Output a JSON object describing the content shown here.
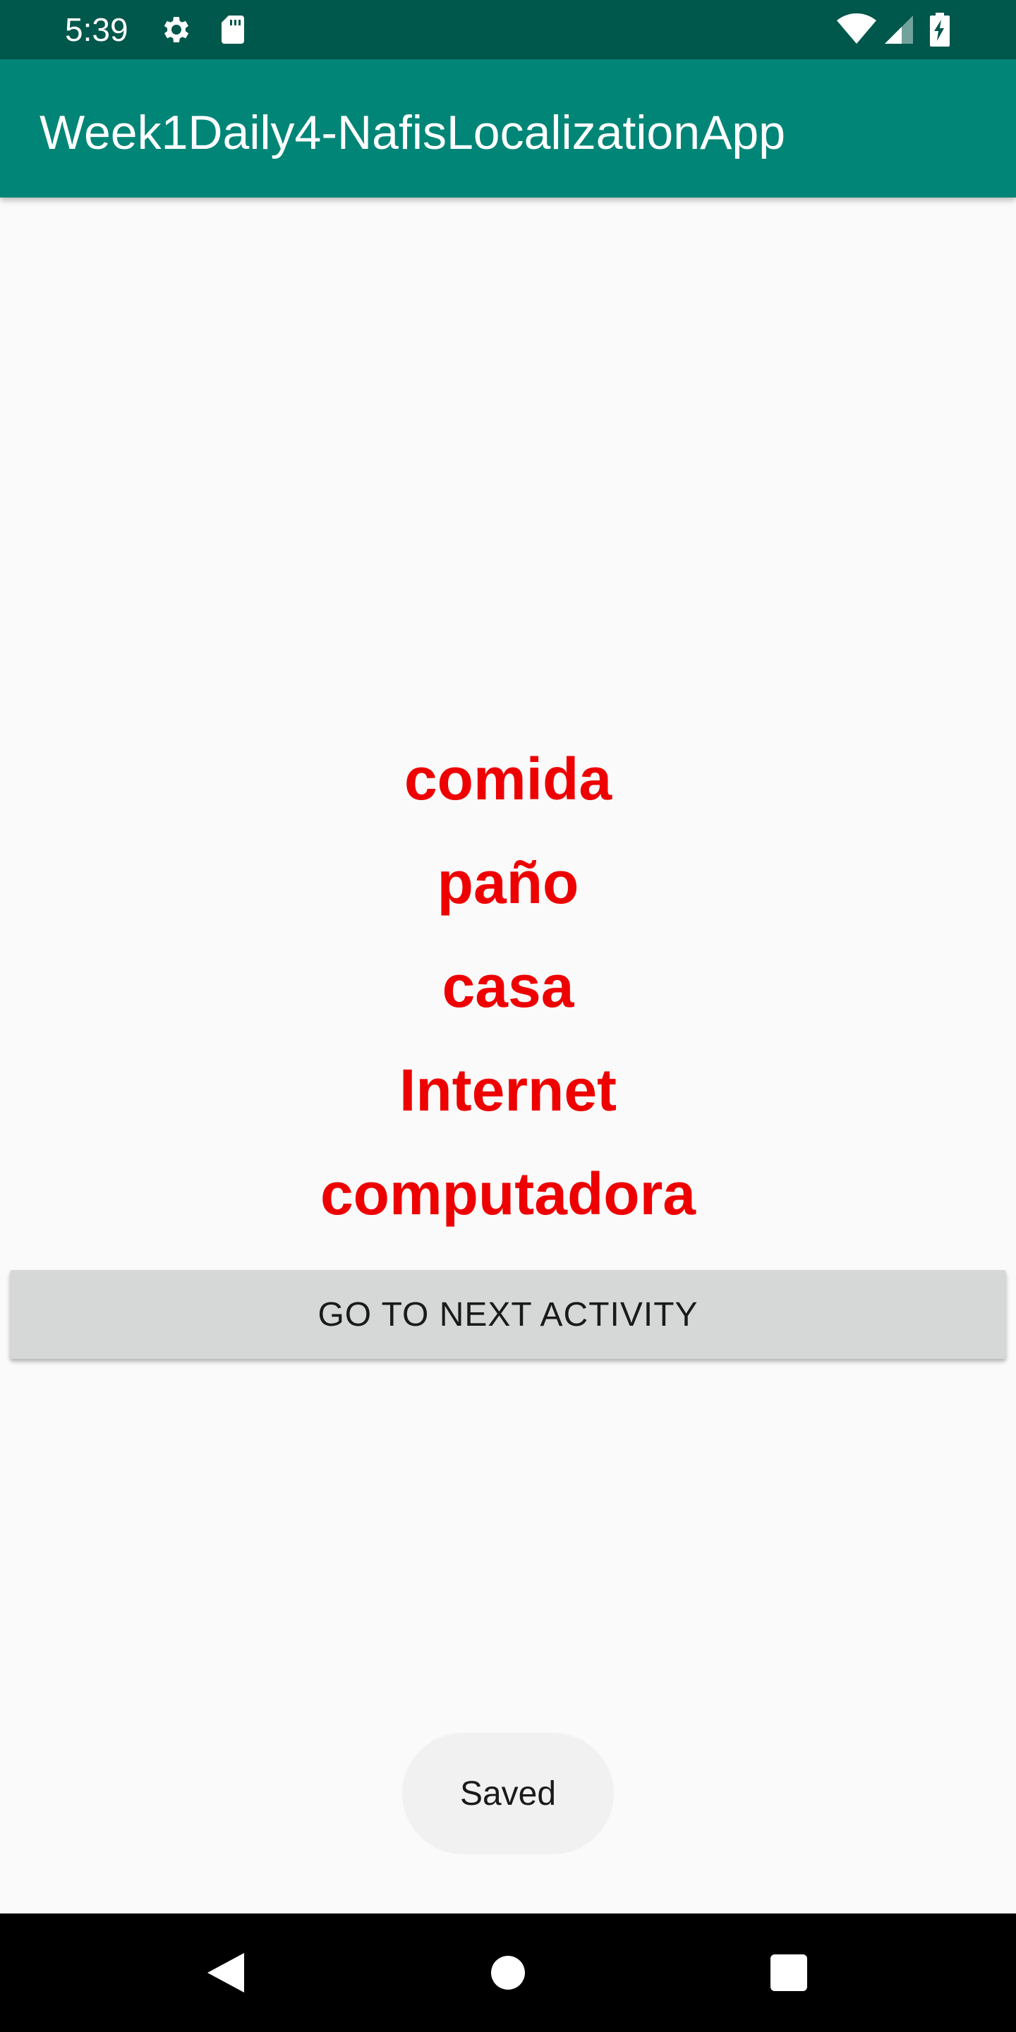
{
  "status_bar": {
    "time": "5:39",
    "icons_left": [
      "gear-icon",
      "sd-card-icon"
    ],
    "icons_right": [
      "wifi-icon",
      "signal-icon",
      "battery-charging-icon"
    ],
    "background": "#00574b"
  },
  "app_bar": {
    "title": "Week1Daily4-NafisLocalizationApp",
    "background": "#008577"
  },
  "words": {
    "items": [
      "comida",
      "paño",
      "casa",
      "Internet",
      "computadora"
    ],
    "color": "#ee0000"
  },
  "button": {
    "label": "GO TO NEXT ACTIVITY"
  },
  "toast": {
    "message": "Saved"
  },
  "nav_bar": {
    "buttons": [
      "back-icon",
      "home-icon",
      "recents-icon"
    ]
  }
}
